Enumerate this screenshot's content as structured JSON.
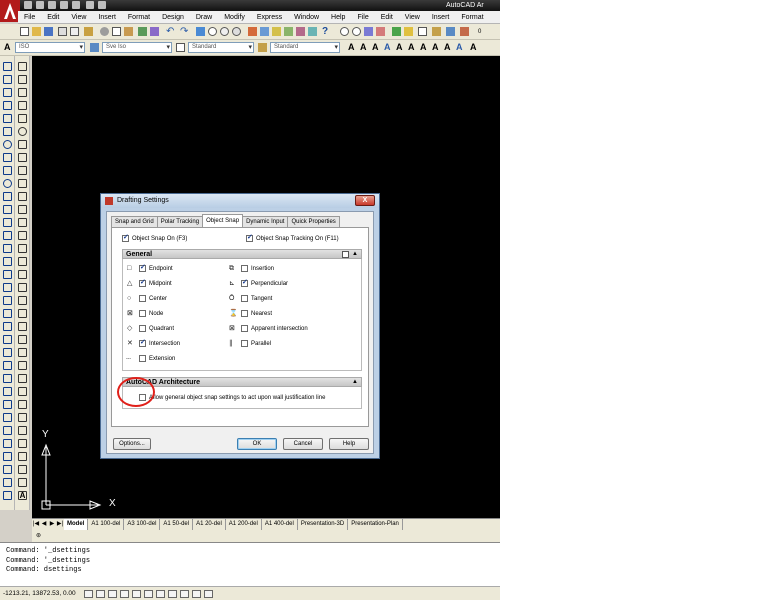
{
  "window": {
    "title": "AutoCAD Ar"
  },
  "menu": [
    "File",
    "Edit",
    "View",
    "Insert",
    "Format",
    "Design",
    "Draw",
    "Modify",
    "Express",
    "Window",
    "Help",
    "File",
    "Edit",
    "View",
    "Insert",
    "Format"
  ],
  "toolbar": {
    "text_style": "ISO",
    "dim_style": "Sve Iso",
    "table_style": "Standard",
    "mleader_style": "Standard",
    "zoom_value": "0"
  },
  "layout_tabs": [
    "Model",
    "A1 100-del",
    "A3 100-del",
    "A1 50-del",
    "A1 20-del",
    "A1 200-del",
    "A1 400-del",
    "Presentation-3D",
    "Presentation-Plan"
  ],
  "ucs": {
    "x_label": "X",
    "y_label": "Y"
  },
  "command_history": [
    "Command: '_dsettings",
    "Command: '_dsettings",
    "Command: dsettings"
  ],
  "status": {
    "coordinates": "-1213.21, 13872.53, 0.00"
  },
  "dialog": {
    "title": "Drafting Settings",
    "close_label": "X",
    "tabs": [
      "Snap and Grid",
      "Polar Tracking",
      "Object Snap",
      "Dynamic Input",
      "Quick Properties"
    ],
    "osnap_on": {
      "label": "Object Snap On (F3)",
      "checked": true
    },
    "osnap_tracking_on": {
      "label": "Object Snap Tracking On (F11)",
      "checked": true
    },
    "general": {
      "title": "General",
      "toggle": "▲",
      "left": [
        {
          "marker": "□",
          "label": "Endpoint",
          "checked": true
        },
        {
          "marker": "△",
          "label": "Midpoint",
          "checked": true
        },
        {
          "marker": "○",
          "label": "Center",
          "checked": false
        },
        {
          "marker": "⊠",
          "label": "Node",
          "checked": false
        },
        {
          "marker": "◇",
          "label": "Quadrant",
          "checked": false
        },
        {
          "marker": "✕",
          "label": "Intersection",
          "checked": true
        },
        {
          "marker": "---",
          "label": "Extension",
          "checked": false
        }
      ],
      "right": [
        {
          "marker": "⧉",
          "label": "Insertion",
          "checked": false
        },
        {
          "marker": "⊾",
          "label": "Perpendicular",
          "checked": true
        },
        {
          "marker": "Ō",
          "label": "Tangent",
          "checked": false
        },
        {
          "marker": "⌛",
          "label": "Nearest",
          "checked": false
        },
        {
          "marker": "⊠",
          "label": "Apparent intersection",
          "checked": false
        },
        {
          "marker": "∥",
          "label": "Parallel",
          "checked": false
        }
      ]
    },
    "architecture": {
      "title": "AutoCAD Architecture",
      "toggle": "▲",
      "allow_label": "Allow general object snap settings to act upon wall justification line",
      "allow_checked": false
    },
    "buttons": {
      "options": "Options...",
      "ok": "OK",
      "cancel": "Cancel",
      "help": "Help"
    }
  }
}
